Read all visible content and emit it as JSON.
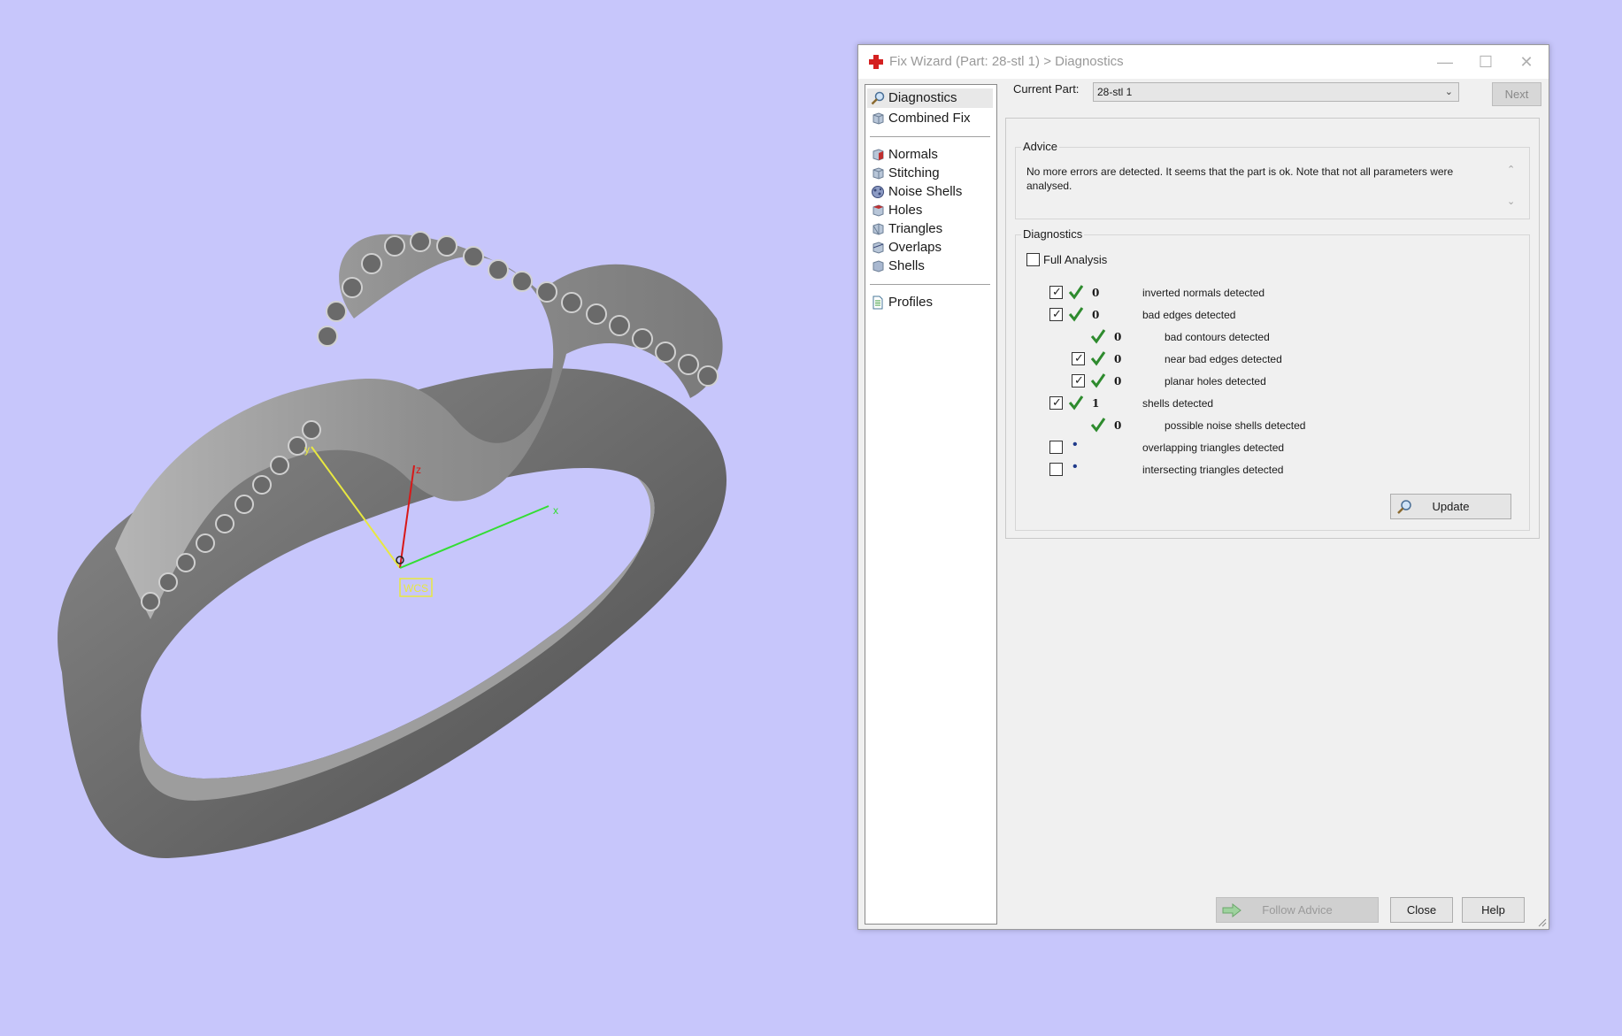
{
  "viewport": {
    "background": "#c7c6fb",
    "axes": {
      "x": "x",
      "y": "y",
      "z": "z",
      "origin_label": "WCS"
    },
    "axis_colors": {
      "x": "#33dd33",
      "y": "#e8e840",
      "z": "#d81818"
    }
  },
  "dialog": {
    "title": "Fix Wizard (Part: 28-stl 1) > Diagnostics",
    "title_icon": "red-cross-icon",
    "nav": {
      "groups": [
        [
          {
            "label": "Diagnostics",
            "icon": "magnifier-icon",
            "selected": true
          },
          {
            "label": "Combined Fix",
            "icon": "cube-icon"
          }
        ],
        [
          {
            "label": "Normals",
            "icon": "normals-cube-icon"
          },
          {
            "label": "Stitching",
            "icon": "stitching-cube-icon"
          },
          {
            "label": "Noise Shells",
            "icon": "noise-shells-icon"
          },
          {
            "label": "Holes",
            "icon": "holes-cube-icon"
          },
          {
            "label": "Triangles",
            "icon": "triangles-cube-icon"
          },
          {
            "label": "Overlaps",
            "icon": "overlaps-cube-icon"
          },
          {
            "label": "Shells",
            "icon": "shells-cube-icon"
          }
        ],
        [
          {
            "label": "Profiles",
            "icon": "document-icon"
          }
        ]
      ]
    },
    "current_part": {
      "label": "Current Part:",
      "value": "28-stl 1"
    },
    "next_label": "Next",
    "advice": {
      "title": "Advice",
      "text": "No more errors are detected. It seems that the part is ok. Note that not all parameters were analysed."
    },
    "diagnostics": {
      "title": "Diagnostics",
      "full_analysis": {
        "label": "Full Analysis",
        "checked": false
      },
      "rows": [
        {
          "checkbox": true,
          "checked": true,
          "status": "ok",
          "count": "0",
          "label": "inverted normals detected",
          "indent": 0
        },
        {
          "checkbox": true,
          "checked": true,
          "status": "ok",
          "count": "0",
          "label": "bad edges detected",
          "indent": 0
        },
        {
          "checkbox": false,
          "checked": false,
          "status": "ok",
          "count": "0",
          "label": "bad contours detected",
          "indent": 1
        },
        {
          "checkbox": true,
          "checked": true,
          "status": "ok",
          "count": "0",
          "label": "near bad edges detected",
          "indent": 1
        },
        {
          "checkbox": true,
          "checked": true,
          "status": "ok",
          "count": "0",
          "label": "planar holes detected",
          "indent": 1
        },
        {
          "checkbox": true,
          "checked": true,
          "status": "ok",
          "count": "1",
          "label": "shells detected",
          "indent": 0
        },
        {
          "checkbox": false,
          "checked": false,
          "status": "ok",
          "count": "0",
          "label": "possible noise shells detected",
          "indent": 1
        },
        {
          "checkbox": true,
          "checked": false,
          "status": "none",
          "count": "",
          "label": "overlapping triangles detected",
          "indent": 0
        },
        {
          "checkbox": true,
          "checked": false,
          "status": "none",
          "count": "",
          "label": "intersecting triangles detected",
          "indent": 0
        }
      ],
      "update_label": "Update"
    },
    "buttons": {
      "follow_advice": "Follow Advice",
      "close": "Close",
      "help": "Help"
    },
    "colors": {
      "check_green": "#2e8b2e",
      "title_red": "#d42020"
    }
  }
}
